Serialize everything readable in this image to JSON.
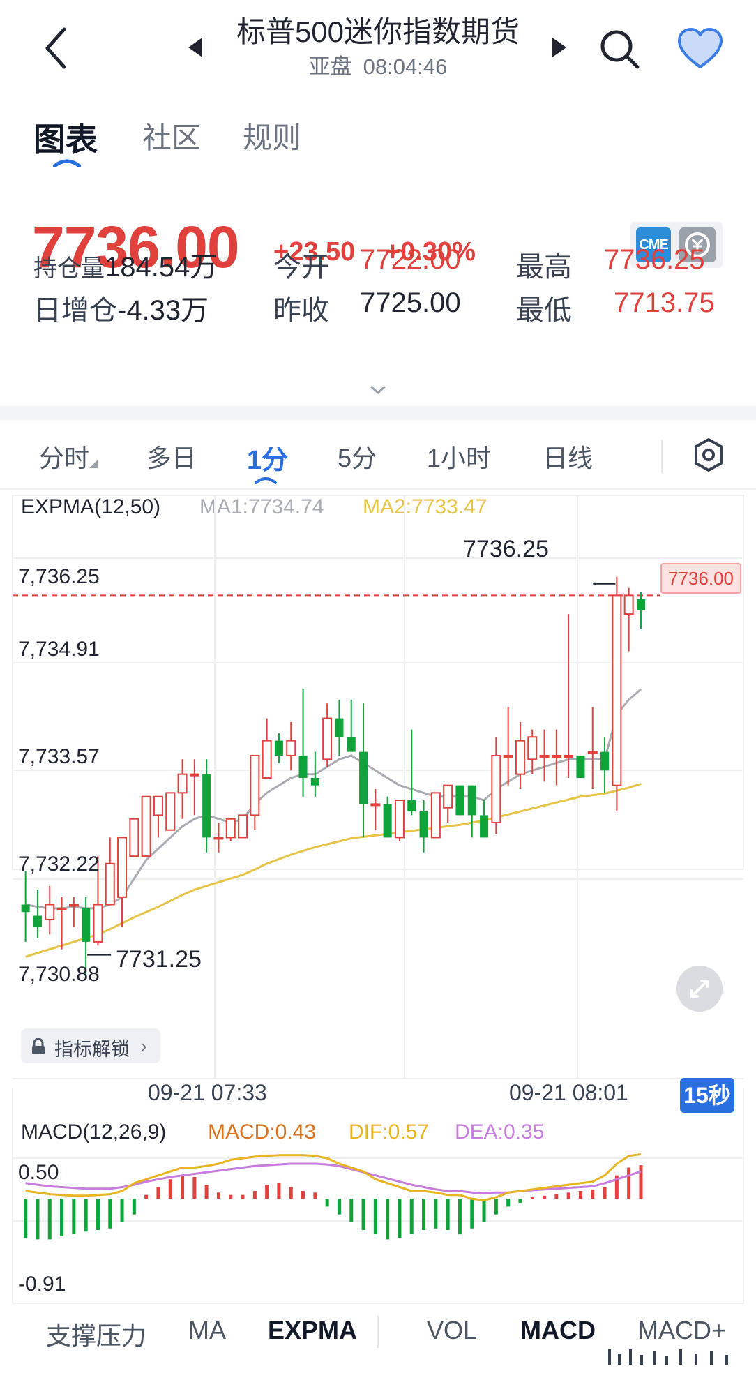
{
  "header": {
    "title": "标普500迷你指数期货",
    "session": "亚盘",
    "time": "08:04:46"
  },
  "main_tabs": [
    "图表",
    "社区",
    "规则"
  ],
  "quote": {
    "price": "7736.00",
    "change": "+23.50",
    "change_pct": "+0.30%",
    "exchange_badge": "CME",
    "open_interest_label": "持仓量",
    "open_interest": "184.54万",
    "oi_change_label": "日增仓",
    "oi_change": "-4.33万",
    "open_label": "今开",
    "open": "7722.00",
    "prev_close_label": "昨收",
    "prev_close": "7725.00",
    "high_label": "最高",
    "high": "7736.25",
    "low_label": "最低",
    "low": "7713.75"
  },
  "period_tabs": [
    "分时",
    "多日",
    "1分",
    "5分",
    "1小时",
    "日线"
  ],
  "active_period": "1分",
  "chart_legend": {
    "indicator": "EXPMA(12,50)",
    "ma1": "MA1:7734.74",
    "ma2": "MA2:7733.47"
  },
  "colors": {
    "up": "#e0413c",
    "down": "#0fa43a",
    "ma1": "#a9adb3",
    "ma2": "#e6c447",
    "macd": "#d9711f",
    "dif": "#e8b421",
    "dea": "#c77ddb",
    "accent": "#2a6fe0"
  },
  "y_axis_labels": [
    "7,736.25",
    "7,734.91",
    "7,733.57",
    "7,732.22",
    "7,730.88"
  ],
  "current_price_tag": "7736.00",
  "high_marker": "7736.25",
  "low_marker": "7731.25",
  "unlock_label": "指标解锁",
  "time_labels": [
    "09-21 07:33",
    "09-21 08:01"
  ],
  "interval_badge": "15秒",
  "macd_legend": {
    "indicator": "MACD(12,26,9)",
    "macd": "MACD:0.43",
    "dif": "DIF:0.57",
    "dea": "DEA:0.35"
  },
  "macd_axis_labels": [
    "0.50",
    "-0.91"
  ],
  "indicator_tabs": [
    "支撑压力",
    "MA",
    "EXPMA",
    "VOL",
    "MACD",
    "MACD+"
  ],
  "chart_data": {
    "type": "candlestick",
    "candles": [
      {
        "o": 7731.85,
        "h": 7732.3,
        "l": 7731.35,
        "c": 7731.75
      },
      {
        "o": 7731.7,
        "h": 7732.05,
        "l": 7731.4,
        "c": 7731.55
      },
      {
        "o": 7731.65,
        "h": 7732.1,
        "l": 7731.45,
        "c": 7731.85
      },
      {
        "o": 7731.8,
        "h": 7731.95,
        "l": 7731.25,
        "c": 7731.8
      },
      {
        "o": 7731.85,
        "h": 7731.95,
        "l": 7731.55,
        "c": 7731.85
      },
      {
        "o": 7731.8,
        "h": 7731.95,
        "l": 7730.9,
        "c": 7731.35
      },
      {
        "o": 7731.35,
        "h": 7732.5,
        "l": 7731.3,
        "c": 7731.85
      },
      {
        "o": 7731.85,
        "h": 7732.75,
        "l": 7731.85,
        "c": 7732.4
      },
      {
        "o": 7731.95,
        "h": 7732.75,
        "l": 7731.55,
        "c": 7732.75
      },
      {
        "o": 7732.5,
        "h": 7733.0,
        "l": 7732.5,
        "c": 7733.0
      },
      {
        "o": 7732.5,
        "h": 7733.3,
        "l": 7732.5,
        "c": 7733.3
      },
      {
        "o": 7733.05,
        "h": 7733.3,
        "l": 7732.75,
        "c": 7733.3
      },
      {
        "o": 7732.85,
        "h": 7733.35,
        "l": 7732.85,
        "c": 7733.35
      },
      {
        "o": 7733.35,
        "h": 7733.8,
        "l": 7733.0,
        "c": 7733.6
      },
      {
        "o": 7733.6,
        "h": 7733.8,
        "l": 7733.05,
        "c": 7733.6
      },
      {
        "o": 7733.6,
        "h": 7733.8,
        "l": 7732.55,
        "c": 7732.75
      },
      {
        "o": 7732.75,
        "h": 7732.95,
        "l": 7732.55,
        "c": 7732.75
      },
      {
        "o": 7732.75,
        "h": 7733.0,
        "l": 7732.7,
        "c": 7733.0
      },
      {
        "o": 7732.75,
        "h": 7733.05,
        "l": 7732.75,
        "c": 7733.05
      },
      {
        "o": 7733.05,
        "h": 7733.85,
        "l": 7732.85,
        "c": 7733.85
      },
      {
        "o": 7733.55,
        "h": 7734.35,
        "l": 7733.55,
        "c": 7734.05
      },
      {
        "o": 7734.05,
        "h": 7734.15,
        "l": 7733.75,
        "c": 7733.85
      },
      {
        "o": 7733.85,
        "h": 7734.3,
        "l": 7733.65,
        "c": 7734.05
      },
      {
        "o": 7733.85,
        "h": 7734.75,
        "l": 7733.3,
        "c": 7733.55
      },
      {
        "o": 7733.55,
        "h": 7733.9,
        "l": 7733.3,
        "c": 7733.45
      },
      {
        "o": 7733.8,
        "h": 7734.55,
        "l": 7733.7,
        "c": 7734.35
      },
      {
        "o": 7734.35,
        "h": 7734.6,
        "l": 7733.85,
        "c": 7734.1
      },
      {
        "o": 7734.1,
        "h": 7734.6,
        "l": 7733.9,
        "c": 7733.9
      },
      {
        "o": 7733.9,
        "h": 7734.55,
        "l": 7732.75,
        "c": 7733.2
      },
      {
        "o": 7733.2,
        "h": 7733.4,
        "l": 7732.85,
        "c": 7733.2
      },
      {
        "o": 7733.2,
        "h": 7733.3,
        "l": 7732.75,
        "c": 7732.75
      },
      {
        "o": 7732.75,
        "h": 7733.25,
        "l": 7732.7,
        "c": 7733.25
      },
      {
        "o": 7733.25,
        "h": 7734.2,
        "l": 7733.05,
        "c": 7733.1
      },
      {
        "o": 7733.1,
        "h": 7733.25,
        "l": 7732.55,
        "c": 7732.75
      },
      {
        "o": 7732.75,
        "h": 7733.35,
        "l": 7732.75,
        "c": 7733.35
      },
      {
        "o": 7733.15,
        "h": 7733.45,
        "l": 7732.95,
        "c": 7733.45
      },
      {
        "o": 7733.45,
        "h": 7733.45,
        "l": 7733.05,
        "c": 7733.05
      },
      {
        "o": 7733.45,
        "h": 7733.45,
        "l": 7732.75,
        "c": 7733.05
      },
      {
        "o": 7733.05,
        "h": 7733.25,
        "l": 7732.75,
        "c": 7732.75
      },
      {
        "o": 7732.95,
        "h": 7734.1,
        "l": 7732.8,
        "c": 7733.85
      },
      {
        "o": 7733.85,
        "h": 7734.5,
        "l": 7733.45,
        "c": 7733.85
      },
      {
        "o": 7733.6,
        "h": 7734.3,
        "l": 7733.4,
        "c": 7734.05
      },
      {
        "o": 7733.8,
        "h": 7734.2,
        "l": 7733.6,
        "c": 7734.1
      },
      {
        "o": 7733.85,
        "h": 7734.2,
        "l": 7733.5,
        "c": 7733.85
      },
      {
        "o": 7733.85,
        "h": 7734.2,
        "l": 7733.45,
        "c": 7733.85
      },
      {
        "o": 7733.85,
        "h": 7735.75,
        "l": 7733.55,
        "c": 7733.85
      },
      {
        "o": 7733.85,
        "h": 7733.85,
        "l": 7733.55,
        "c": 7733.55
      },
      {
        "o": 7733.9,
        "h": 7734.5,
        "l": 7733.4,
        "c": 7733.9
      },
      {
        "o": 7733.9,
        "h": 7734.1,
        "l": 7733.35,
        "c": 7733.65
      },
      {
        "o": 7733.45,
        "h": 7736.25,
        "l": 7733.1,
        "c": 7736.0
      },
      {
        "o": 7735.75,
        "h": 7736.1,
        "l": 7735.25,
        "c": 7736.0
      },
      {
        "o": 7735.95,
        "h": 7736.05,
        "l": 7735.55,
        "c": 7735.8
      }
    ],
    "ma1": [
      7731.85,
      7731.82,
      7731.8,
      7731.8,
      7731.82,
      7731.8,
      7731.8,
      7731.85,
      7731.95,
      7732.2,
      7732.45,
      7732.6,
      7732.75,
      7732.9,
      7733.0,
      7733.05,
      7733.0,
      7732.95,
      7733.0,
      7733.2,
      7733.35,
      7733.45,
      7733.55,
      7733.6,
      7733.6,
      7733.7,
      7733.8,
      7733.85,
      7733.75,
      7733.65,
      7733.55,
      7733.45,
      7733.4,
      7733.35,
      7733.3,
      7733.3,
      7733.3,
      7733.3,
      7733.25,
      7733.4,
      7733.5,
      7733.6,
      7733.65,
      7733.7,
      7733.75,
      7733.8,
      7733.8,
      7733.8,
      7733.8,
      7734.4,
      7734.6,
      7734.74
    ],
    "ma2": [
      7731.15,
      7731.2,
      7731.25,
      7731.3,
      7731.35,
      7731.4,
      7731.45,
      7731.52,
      7731.6,
      7731.68,
      7731.75,
      7731.82,
      7731.9,
      7731.98,
      7732.05,
      7732.1,
      7732.15,
      7732.2,
      7732.25,
      7732.32,
      7732.4,
      7732.46,
      7732.52,
      7732.57,
      7732.62,
      7732.66,
      7732.7,
      7732.74,
      7732.76,
      7732.78,
      7732.8,
      7732.82,
      7732.84,
      7732.86,
      7732.88,
      7732.9,
      7732.92,
      7732.95,
      7732.98,
      7733.02,
      7733.06,
      7733.1,
      7733.14,
      7733.18,
      7733.22,
      7733.26,
      7733.3,
      7733.32,
      7733.34,
      7733.38,
      7733.42,
      7733.47
    ],
    "macd_hist": [
      -0.5,
      -0.52,
      -0.52,
      -0.48,
      -0.45,
      -0.42,
      -0.4,
      -0.38,
      -0.3,
      -0.2,
      0.05,
      0.15,
      0.25,
      0.3,
      0.28,
      0.18,
      0.08,
      0.05,
      0.05,
      0.1,
      0.18,
      0.2,
      0.15,
      0.1,
      0.08,
      -0.1,
      -0.2,
      -0.3,
      -0.4,
      -0.45,
      -0.52,
      -0.5,
      -0.45,
      -0.4,
      -0.38,
      -0.4,
      -0.45,
      -0.38,
      -0.3,
      -0.2,
      -0.1,
      -0.05,
      0.02,
      0.04,
      0.06,
      0.08,
      0.1,
      0.12,
      0.15,
      0.3,
      0.4,
      0.43
    ],
    "dif": [
      0.1,
      0.08,
      0.06,
      0.05,
      0.04,
      0.04,
      0.05,
      0.06,
      0.1,
      0.2,
      0.25,
      0.3,
      0.35,
      0.4,
      0.4,
      0.42,
      0.45,
      0.5,
      0.52,
      0.54,
      0.55,
      0.56,
      0.56,
      0.56,
      0.55,
      0.52,
      0.45,
      0.4,
      0.35,
      0.25,
      0.2,
      0.15,
      0.1,
      0.1,
      0.08,
      0.05,
      0.05,
      0.0,
      -0.02,
      0.02,
      0.08,
      0.1,
      0.12,
      0.14,
      0.16,
      0.18,
      0.2,
      0.22,
      0.3,
      0.45,
      0.55,
      0.57
    ],
    "dea": [
      0.2,
      0.18,
      0.16,
      0.15,
      0.14,
      0.13,
      0.13,
      0.13,
      0.15,
      0.18,
      0.22,
      0.25,
      0.28,
      0.3,
      0.32,
      0.34,
      0.36,
      0.38,
      0.4,
      0.42,
      0.43,
      0.44,
      0.45,
      0.45,
      0.45,
      0.44,
      0.42,
      0.38,
      0.34,
      0.3,
      0.26,
      0.22,
      0.18,
      0.15,
      0.12,
      0.1,
      0.1,
      0.08,
      0.07,
      0.08,
      0.08,
      0.1,
      0.11,
      0.12,
      0.13,
      0.14,
      0.15,
      0.16,
      0.2,
      0.25,
      0.3,
      0.35
    ]
  }
}
